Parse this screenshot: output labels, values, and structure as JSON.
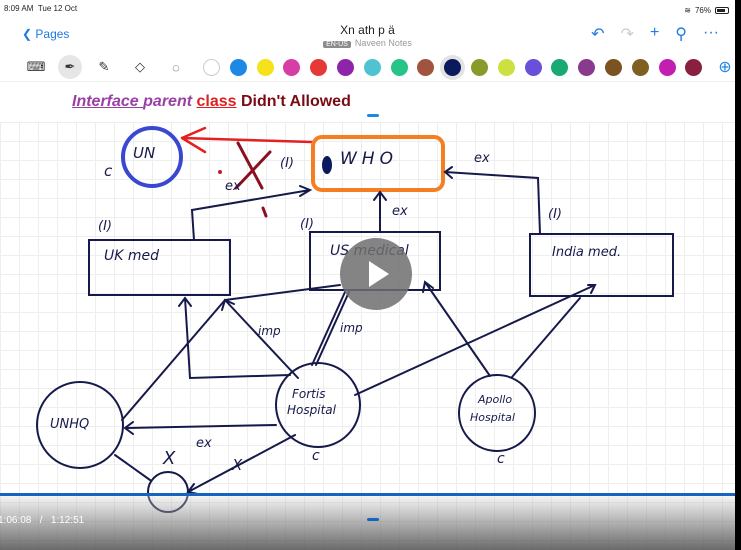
{
  "status_bar": {
    "time": "8:09 AM",
    "date": "Tue 12 Oct",
    "battery": "76%"
  },
  "nav": {
    "back_label": "Pages",
    "title": "Xn ath p ä",
    "language_badge": "EN-US",
    "notebook": "Naveen Notes"
  },
  "toolbar": {
    "tools": [
      "keyboard-icon",
      "pen-icon",
      "highlighter-icon",
      "eraser-icon",
      "lasso-icon"
    ],
    "colors": [
      "#ffffff",
      "#1e88e5",
      "#f5e21b",
      "#d63ea5",
      "#e53935",
      "#8e24aa",
      "#4fc3cf",
      "#26c486",
      "#a0533f",
      "#0b1a5c",
      "#8a9a2a",
      "#cde042",
      "#6a4fd8",
      "#1aa873",
      "#8a3a8c",
      "#7a5320",
      "#806020",
      "#c21fb0",
      "#8a2040"
    ],
    "selected_color": "#0b1a5c"
  },
  "heading": {
    "part1": "Interface ",
    "part2": "parent ",
    "part3": "class",
    "part4": " Didn't Allowed"
  },
  "diagram": {
    "un": "UN",
    "who": "WHO",
    "uk": "UK med",
    "us": "US medical",
    "india": "India med.",
    "unhq": "UNHQ",
    "fortis1": "Fortis",
    "fortis2": "Hospital",
    "apollo1": "Apollo",
    "apollo2": "Hospital",
    "ex": "ex",
    "imp": "imp",
    "interface_mark": "(I)",
    "class_mark": "c",
    "cross": "X"
  },
  "video": {
    "current_time": "1:06:08",
    "separator": "/",
    "duration": "1:12:51",
    "progress": 0.908
  }
}
